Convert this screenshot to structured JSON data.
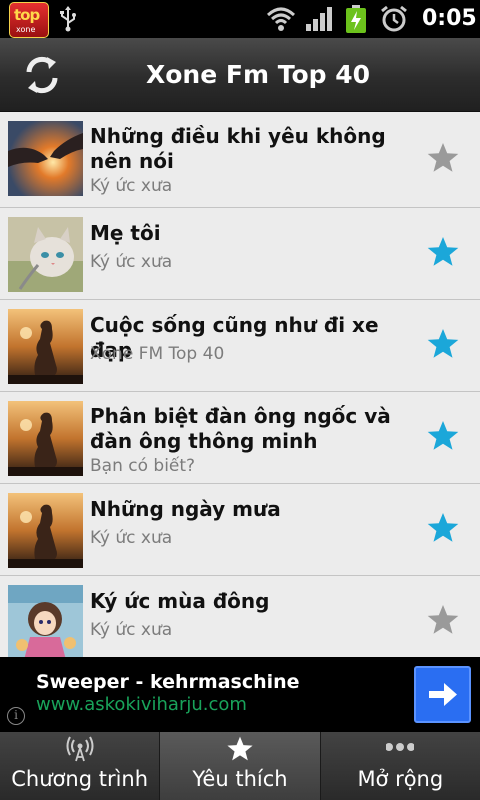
{
  "status_bar": {
    "app_icon_text": "top",
    "app_icon_sub": "xone",
    "time": "0:05"
  },
  "header": {
    "title": "Xone Fm Top 40"
  },
  "items": [
    {
      "title": "Những điều khi yêu không nên nói",
      "subtitle": "Ký ức xưa",
      "favorite": false,
      "thumb": "hands-sunset"
    },
    {
      "title": "Mẹ tôi",
      "subtitle": "Ký ức xưa",
      "favorite": true,
      "thumb": "kitten"
    },
    {
      "title": "Cuộc sống cũng như đi xe đạp",
      "subtitle": "Xone FM Top 40",
      "favorite": true,
      "thumb": "girl-sunset"
    },
    {
      "title": "Phân biệt đàn ông ngốc và đàn ông thông minh",
      "subtitle": "Bạn có biết?",
      "favorite": true,
      "thumb": "girl-sunset"
    },
    {
      "title": "Những ngày mưa",
      "subtitle": "Ký ức xưa",
      "favorite": true,
      "thumb": "girl-sunset"
    },
    {
      "title": "Ký ức mùa đông",
      "subtitle": "Ký ức xưa",
      "favorite": false,
      "thumb": "anime-girl"
    }
  ],
  "ad": {
    "title": "Sweeper - kehrmaschine",
    "url": "www.askokiviharju.com",
    "info": "i"
  },
  "tabs": [
    {
      "label": "Chương trình",
      "icon": "broadcast-icon",
      "selected": false
    },
    {
      "label": "Yêu thích",
      "icon": "star-icon",
      "selected": true
    },
    {
      "label": "Mở rộng",
      "icon": "more-dots-icon",
      "selected": false
    }
  ],
  "colors": {
    "star_on": "#1ba7d9",
    "star_off": "#9a9a9a",
    "ad_url": "#19a35a",
    "ad_button": "#2a6ef2"
  }
}
